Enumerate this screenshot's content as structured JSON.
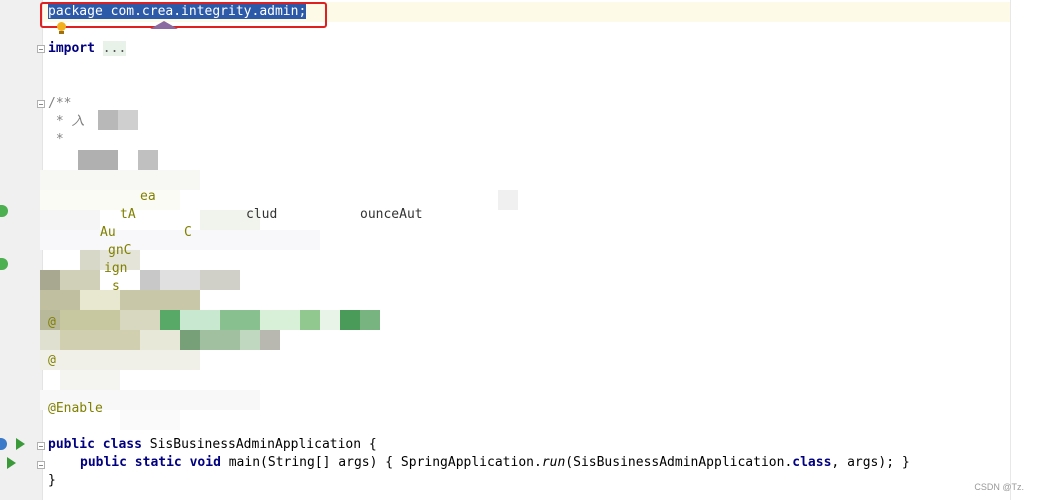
{
  "editor": {
    "package_line": "package com.crea.integrity.admin;",
    "import_keyword": "import",
    "import_collapsed": "...",
    "comment_open": "/**",
    "comment_line1_prefix": " * ",
    "comment_line1_visible": "入",
    "comment_line2": " *",
    "comment_obscured_fragments": {
      "l1": "ea",
      "l2": "tA",
      "l3": "clud",
      "l4": "ounceAut",
      "l5": "Au",
      "l6": "C",
      "l7": "gnC",
      "l8": "ign",
      "l9": "s",
      "l10": "@",
      "l11": "@",
      "l12": "@Enable"
    },
    "class_decl": {
      "public": "public",
      "class": "class",
      "name": "SisBusinessAdminApplication",
      "brace": " {"
    },
    "main_decl": {
      "public": "public",
      "static": "static",
      "void": "void",
      "signature": " main(String[] args) { SpringApplication.",
      "run": "run",
      "call_args": "(SisBusinessAdminApplication.",
      "class_kw": "class",
      "tail": ", args); }"
    },
    "closing_brace": "}"
  },
  "watermark": "CSDN @Tz.",
  "colors": {
    "keyword": "#000080",
    "annotation": "#808000",
    "comment": "#808080",
    "selection": "#2d5aa8",
    "highlight_box": "#e02020"
  },
  "icons": [
    "lightbulb-icon",
    "run-class-icon",
    "run-main-icon",
    "spring-bean-icon",
    "fold-icon"
  ]
}
